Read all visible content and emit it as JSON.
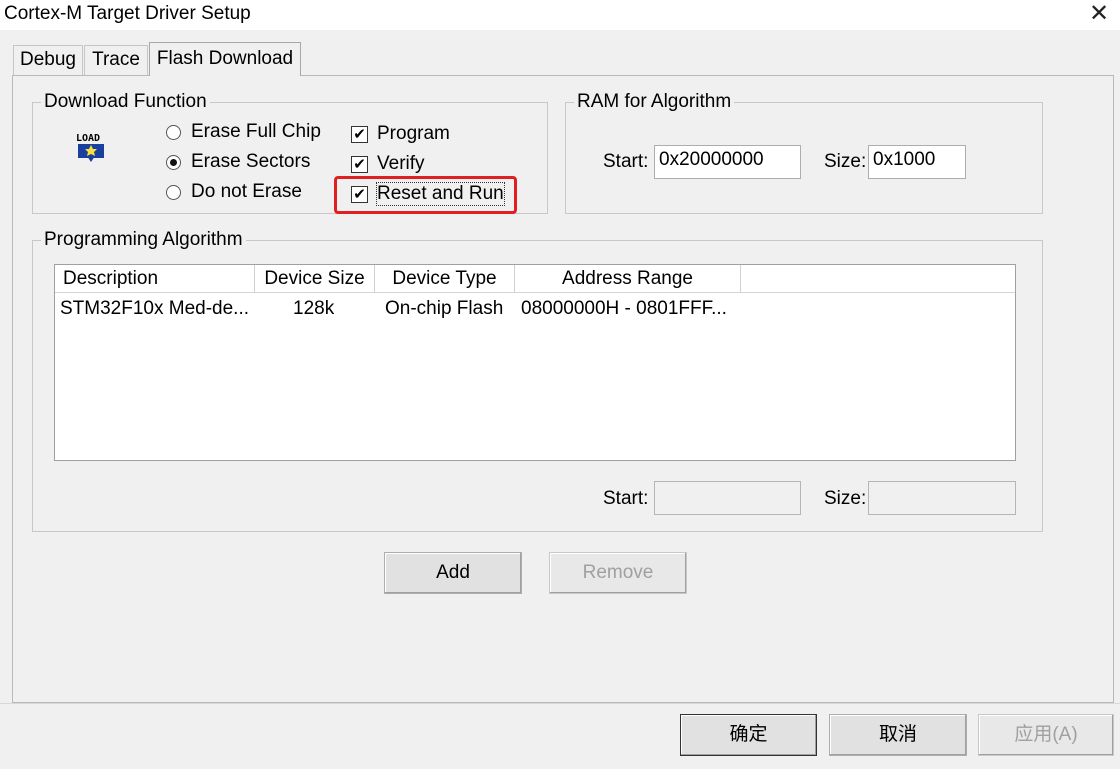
{
  "window": {
    "title": "Cortex-M Target Driver Setup",
    "close_glyph": "✕"
  },
  "tabs": [
    {
      "label": "Debug"
    },
    {
      "label": "Trace"
    },
    {
      "label": "Flash Download"
    }
  ],
  "download_function": {
    "title": "Download Function",
    "icon_text": "LOAD",
    "radios": [
      {
        "label": "Erase Full Chip",
        "selected": false
      },
      {
        "label": "Erase Sectors",
        "selected": true
      },
      {
        "label": "Do not Erase",
        "selected": false
      }
    ],
    "checks": [
      {
        "label": "Program",
        "checked": true
      },
      {
        "label": "Verify",
        "checked": true
      },
      {
        "label": "Reset and Run",
        "checked": true
      }
    ],
    "check_glyph": "✔"
  },
  "ram": {
    "title": "RAM for Algorithm",
    "start_label": "Start:",
    "start_value": "0x20000000",
    "size_label": "Size:",
    "size_value": "0x1000"
  },
  "programming": {
    "title": "Programming Algorithm",
    "columns": [
      "Description",
      "Device Size",
      "Device Type",
      "Address Range"
    ],
    "rows": [
      {
        "description": "STM32F10x Med-de...",
        "size": "128k",
        "type": "On-chip Flash",
        "range": "08000000H - 0801FFF..."
      }
    ],
    "start_label": "Start:",
    "start_value": "",
    "size_label": "Size:",
    "size_value": ""
  },
  "buttons": {
    "add": "Add",
    "remove": "Remove"
  },
  "footer": {
    "ok": "确定",
    "cancel": "取消",
    "apply": "应用(A)"
  },
  "colors": {
    "highlight": "#e02020",
    "window_bg": "#f0f0f0"
  }
}
